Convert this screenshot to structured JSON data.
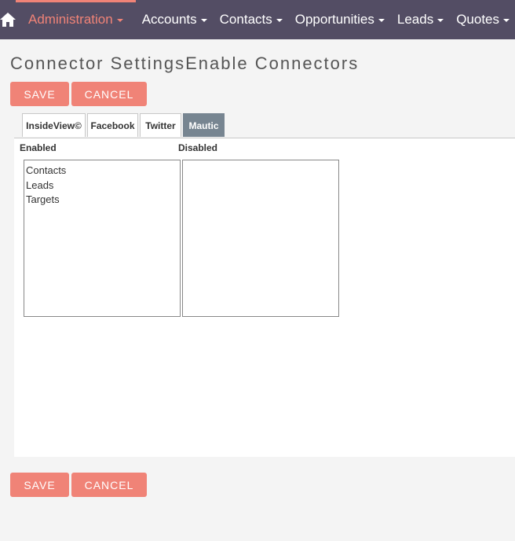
{
  "nav": {
    "home_icon": "home-icon",
    "items": [
      {
        "label": "Administration",
        "active": true
      },
      {
        "label": "Accounts"
      },
      {
        "label": "Contacts"
      },
      {
        "label": "Opportunities"
      },
      {
        "label": "Leads"
      },
      {
        "label": "Quotes"
      }
    ]
  },
  "page": {
    "title": "Connector SettingsEnable Connectors"
  },
  "buttons": {
    "save_label": "SAVE",
    "cancel_label": "CANCEL"
  },
  "tabs": [
    {
      "label": "InsideView©"
    },
    {
      "label": "Facebook"
    },
    {
      "label": "Twitter"
    },
    {
      "label": "Mautic",
      "active": true
    }
  ],
  "enabled": {
    "label": "Enabled",
    "options": [
      "Contacts",
      "Leads",
      "Targets"
    ]
  },
  "disabled": {
    "label": "Disabled",
    "options": []
  },
  "colors": {
    "nav_bg": "#534d64",
    "accent": "#f08377",
    "active_tab": "#778591"
  }
}
